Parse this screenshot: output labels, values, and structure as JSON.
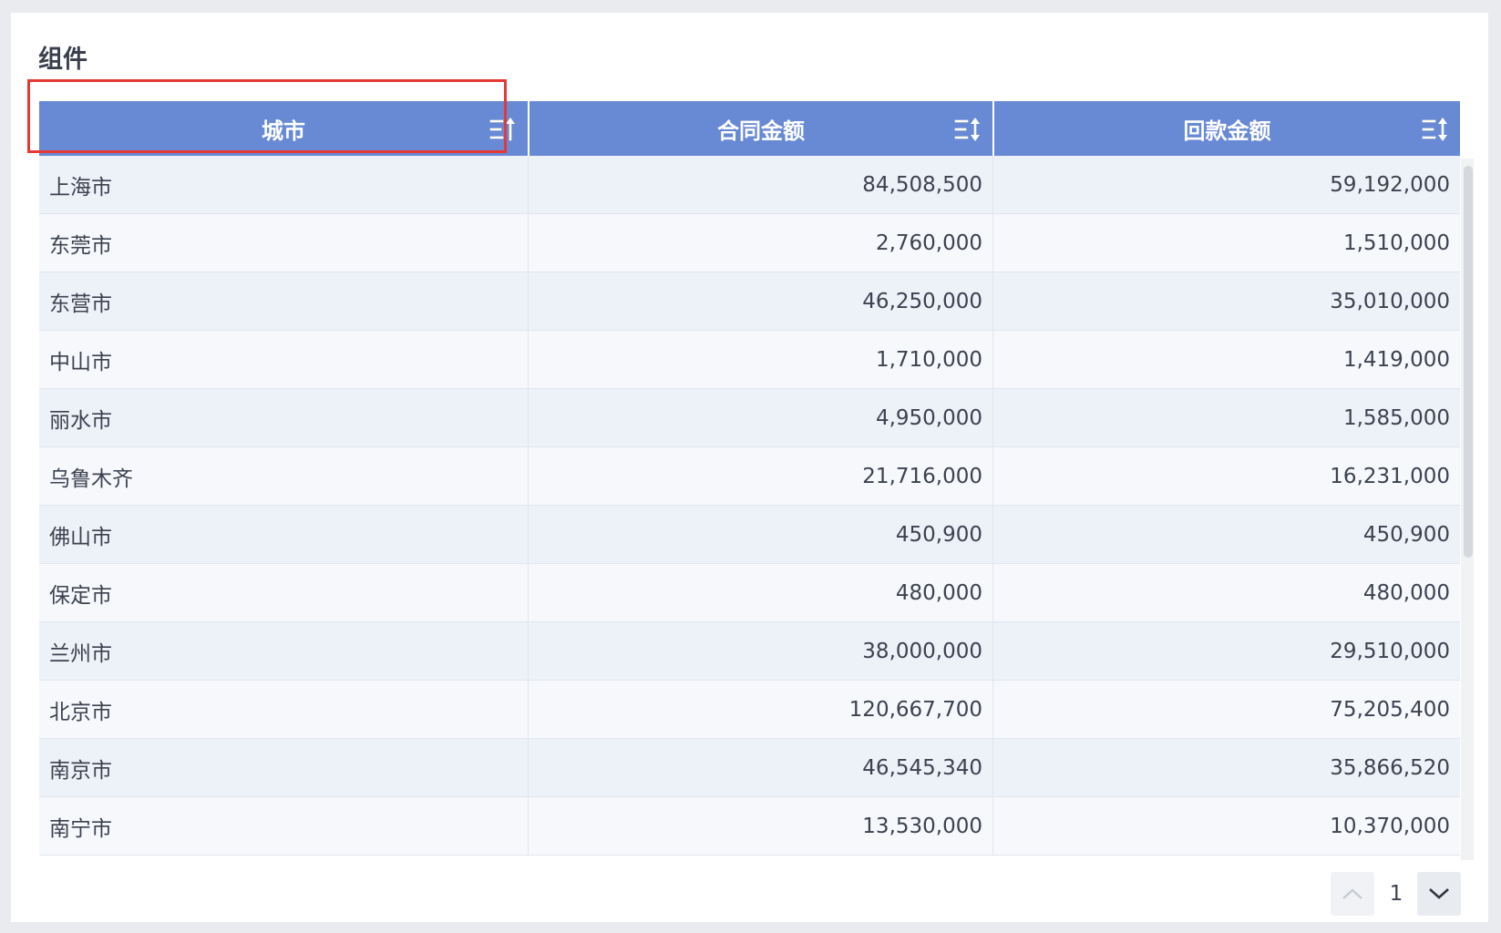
{
  "panel": {
    "title": "组件"
  },
  "table": {
    "columns": [
      {
        "label": "城市",
        "sort_icon": "sort-ascending-icon"
      },
      {
        "label": "合同金额",
        "sort_icon": "sort-both-icon"
      },
      {
        "label": "回款金额",
        "sort_icon": "sort-both-icon"
      }
    ],
    "rows": [
      [
        "上海市",
        "84,508,500",
        "59,192,000"
      ],
      [
        "东莞市",
        "2,760,000",
        "1,510,000"
      ],
      [
        "东营市",
        "46,250,000",
        "35,010,000"
      ],
      [
        "中山市",
        "1,710,000",
        "1,419,000"
      ],
      [
        "丽水市",
        "4,950,000",
        "1,585,000"
      ],
      [
        "乌鲁木齐",
        "21,716,000",
        "16,231,000"
      ],
      [
        "佛山市",
        "450,900",
        "450,900"
      ],
      [
        "保定市",
        "480,000",
        "480,000"
      ],
      [
        "兰州市",
        "38,000,000",
        "29,510,000"
      ],
      [
        "北京市",
        "120,667,700",
        "75,205,400"
      ],
      [
        "南京市",
        "46,545,340",
        "35,866,520"
      ],
      [
        "南宁市",
        "13,530,000",
        "10,370,000"
      ]
    ]
  },
  "pager": {
    "current_page": "1",
    "prev_icon": "chevron-up-icon",
    "next_icon": "chevron-down-icon"
  },
  "colors": {
    "header_bg": "#6889d4",
    "highlight": "#e53935",
    "row_odd": "#edf1f8",
    "row_even": "#f6f8fc"
  }
}
